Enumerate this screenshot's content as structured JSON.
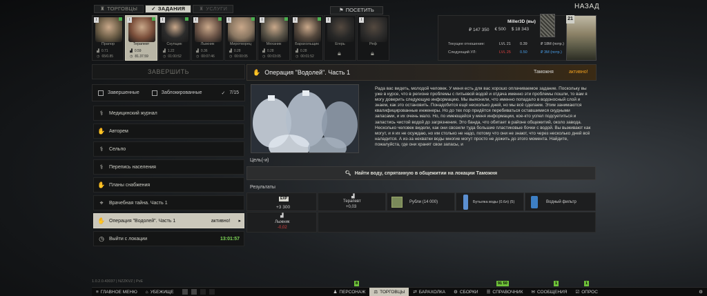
{
  "top_tabs": [
    {
      "label": "ТОРГОВЦЫ",
      "icon": "trader-icon"
    },
    {
      "label": "ЗАДАНИЯ",
      "icon": "check-icon"
    },
    {
      "label": "УСЛУГИ",
      "icon": "services-icon"
    }
  ],
  "visit_label": "ПОСЕТИТЬ",
  "back_label": "НАЗАД",
  "traders": [
    {
      "name": "Прапор",
      "level": "",
      "rep": "0.71",
      "spent": "65/0.85",
      "color": "#6b5d46",
      "locked": false
    },
    {
      "name": "Терапевт",
      "level": "",
      "rep": "0.59",
      "spent": "81.37.59",
      "color": "#7a4e3a",
      "locked": false
    },
    {
      "name": "Скупщик",
      "level": "",
      "rep": "1.22",
      "spent": "01:00:52",
      "color": "#2b2b2b",
      "locked": false
    },
    {
      "name": "Лыжник",
      "level": "",
      "rep": "0.36",
      "spent": "00:07:46",
      "color": "#6a5346",
      "locked": false
    },
    {
      "name": "Миротворец",
      "level": "",
      "rep": "0.28",
      "spent": "00:00:05",
      "color": "#8a7762",
      "locked": false
    },
    {
      "name": "Механик",
      "level": "",
      "rep": "0.28",
      "spent": "00:03:05",
      "color": "#5a5448",
      "locked": false
    },
    {
      "name": "Барахольщик",
      "level": "",
      "rep": "0.28",
      "spent": "00:01:52",
      "color": "#53473c",
      "locked": false
    },
    {
      "name": "Егерь",
      "level": "",
      "rep": "",
      "spent": "",
      "color": "#4a4844",
      "locked": true
    },
    {
      "name": "Реф",
      "level": "",
      "rep": "",
      "spent": "",
      "color": "#5a5550",
      "locked": true
    }
  ],
  "player": {
    "name": "Miller3D (вы)",
    "rub": "₽ 147 350",
    "eur": "€ 500",
    "usd": "$ 18 343",
    "level": "21",
    "current_relation_label": "Текущее отношение:",
    "next_level_label": "Следующий УЛ:",
    "current": {
      "lvl": "LVL 21",
      "rep": "0.39",
      "money": "₽ 18M (потр.)"
    },
    "next": {
      "lvl": "LVL 25",
      "rep": "0.50",
      "money": "₽ 3M (потр.)"
    }
  },
  "left": {
    "finish_label": "ЗАВЕРШИТЬ",
    "filter_completed": "Завершенные",
    "filter_blocked": "Заблокированные",
    "count": "7/15",
    "tasks": [
      {
        "label": "Медицинский журнал",
        "icon": "quest-icon",
        "right": "",
        "active": false
      },
      {
        "label": "Авторем",
        "icon": "hand-icon",
        "right": "",
        "active": false
      },
      {
        "label": "Сельпо",
        "icon": "quest-icon",
        "right": "",
        "active": false
      },
      {
        "label": "Перепись населения",
        "icon": "quest-icon",
        "right": "",
        "active": false
      },
      {
        "label": "Планы снабжения",
        "icon": "hand-icon",
        "right": "",
        "active": false
      },
      {
        "label": "Врачебная тайна. Часть 1",
        "icon": "pin-icon",
        "right": "",
        "active": false
      },
      {
        "label": "Операция \"Водолей\". Часть 1",
        "icon": "hand-icon",
        "right": "активно!",
        "active": true
      },
      {
        "label": "Выйти с локации",
        "icon": "clock-icon",
        "right": "13:01:57",
        "active": false
      }
    ]
  },
  "quest": {
    "title": "Операция \"Водолей\". Часть 1",
    "location": "Таможня",
    "status": "активно!",
    "description": "Рада вас видеть, молодой человек. У меня есть для вас хорошо оплачиваемое задание. Поскольку вы уже в курсе, что в регионе проблемы с питьевой водой и отдача именно эти проблемы пошли, то вам я могу доверить следующую информацию. Мы выяснили, что именно попадало в водоносный слой и знаем, как это остановить. Понадобится ещё несколько дней, но мы всё сделаем. Этим занимаются квалифицированные инженеры. Но до тех пор придётся перебиваться оставшимися скудными запасами, и их очень мало. Но, по имеющейся у меня информации, кое-кто успел подсуетиться и запастись чистой водой до загрязнения. Это банда, что обитает в районе общежитий, около завода. Несколько человек видели, как они свозили туда большие пластиковые бочки с водой. Вы выживают как могут, и я их не осуждаю, но им столько не надо, потому что они не знают, что через несколько дней всё наладится. А из-за нехватки воды многие могут просто не дожить до этого момента. Найдите, пожалуйста, где они хранят свои запасы, и",
    "goal_label": "Цель(-и)",
    "goal": "Найти воду, спрятанную в общежитии на локации Таможня",
    "results_label": "Результаты",
    "rewards": {
      "exp_badge": "EXP",
      "exp": "+3 300",
      "therapist_name": "Терапевт",
      "therapist_rep": "+0,03",
      "skier_name": "Лыжник",
      "skier_rep": "-0,02",
      "items": [
        {
          "label": "Рубли (14 000)",
          "icon": "rubles-icon"
        },
        {
          "label": "Бутылка воды (0.6л) (5)",
          "icon": "water-bottle-icon"
        },
        {
          "label": "Водный фильтр",
          "icon": "water-filter-icon"
        }
      ]
    }
  },
  "bottom": {
    "version": "1.0.2.0.43037 | NZZKVZ | PvE",
    "items": [
      {
        "label": "ГЛАВНОЕ МЕНЮ",
        "icon": "menu-icon"
      },
      {
        "label": "УБЕЖИЩЕ",
        "icon": "hideout-icon"
      },
      {
        "label": "ПЕРСОНАЖ",
        "icon": "character-icon",
        "badge": "8"
      },
      {
        "label": "ТОРГОВЦЫ",
        "icon": "traders-icon",
        "active": true
      },
      {
        "label": "БАРАХОЛКА",
        "icon": "flea-icon"
      },
      {
        "label": "СБОРКИ",
        "icon": "builds-icon"
      },
      {
        "label": "СПРАВОЧНИК",
        "icon": "handbook-icon",
        "badge": "91 50"
      },
      {
        "label": "СООБЩЕНИЯ",
        "icon": "messages-icon",
        "badge": "1"
      },
      {
        "label": "ОПРОС",
        "icon": "survey-icon",
        "badge": "1"
      }
    ]
  }
}
